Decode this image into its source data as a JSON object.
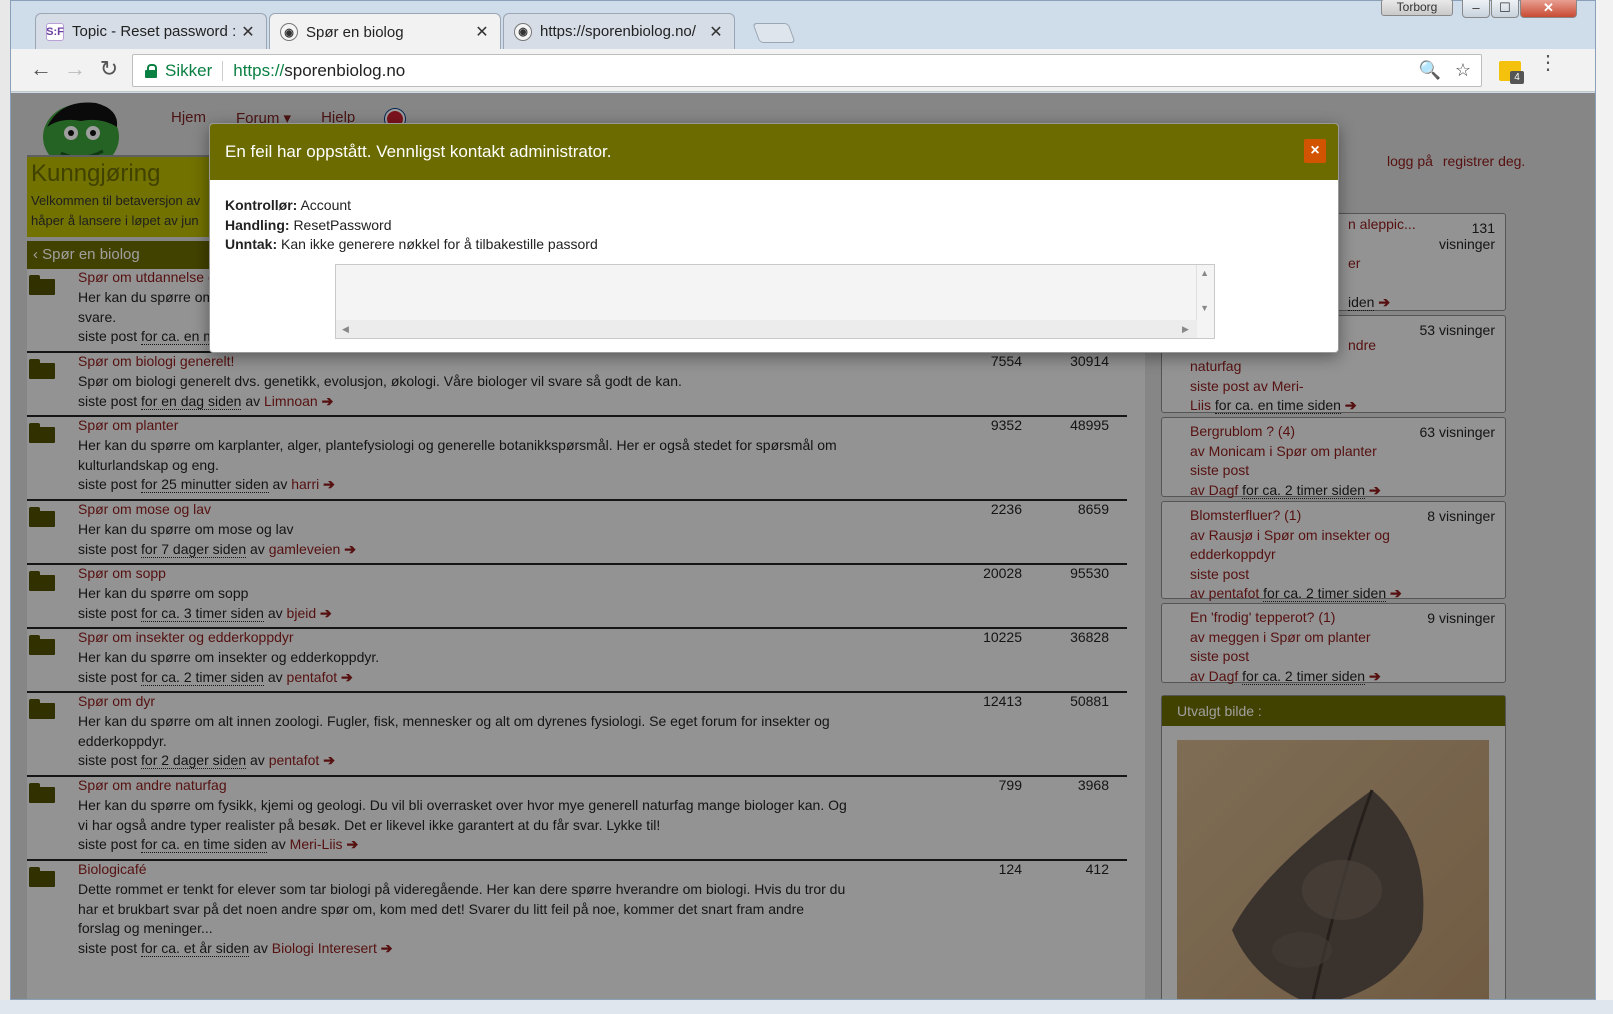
{
  "window": {
    "user_name": "Torborg",
    "min_glyph": "‒",
    "max_glyph": "☐",
    "close_glyph": "✕"
  },
  "tabs": [
    {
      "title": "Topic - Reset password :",
      "favicon": "S:F",
      "close": "✕"
    },
    {
      "title": "Spør en biolog",
      "favicon": "◉",
      "close": "✕"
    },
    {
      "title": "https://sporenbiolog.no/",
      "favicon": "◉",
      "close": "✕"
    }
  ],
  "toolbar": {
    "back": "←",
    "forward": "→",
    "reload": "↻",
    "secure_label": "Sikker",
    "url_scheme": "https://",
    "url_host": "sporenbiolog.no",
    "zoom_icon": "🔍",
    "star_icon": "☆",
    "ext_badge": "4",
    "menu": "⋮"
  },
  "nav": {
    "home": "Hjem",
    "forum": "Forum ▾",
    "help": "Hjelp"
  },
  "announcement": {
    "title": "Kunngjøring",
    "line1": "Velkommen til betaversjon av",
    "line2": "håper å lansere i løpet av jun"
  },
  "auth": {
    "login": "logg på",
    "register": "registrer deg."
  },
  "breadcrumb": "Spør en biolog",
  "forums": [
    {
      "title": "Spør om utdannelse o",
      "desc": "Her kan du spørre om",
      "desc2": "svare.",
      "ago": "for ca. en m",
      "by": "",
      "n1": "",
      "n2": ""
    },
    {
      "title": "Spør om biologi generelt!",
      "desc": "Spør om biologi generelt dvs. genetikk, evolusjon, økologi. Våre biologer vil svare så godt de kan.",
      "ago": "for en dag siden",
      "by": "Limnoan",
      "n1": "7554",
      "n2": "30914"
    },
    {
      "title": "Spør om planter",
      "desc": "Her kan du spørre om karplanter, alger, plantefysiologi og generelle botanikkspørsmål. Her er også stedet for spørsmål om kulturlandskap og eng.",
      "ago": "for 25 minutter siden",
      "by": "harri",
      "n1": "9352",
      "n2": "48995"
    },
    {
      "title": "Spør om mose og lav",
      "desc": "Her kan du spørre om mose og lav",
      "ago": "for 7 dager siden",
      "by": "gamleveien",
      "n1": "2236",
      "n2": "8659"
    },
    {
      "title": "Spør om sopp",
      "desc": "Her kan du spørre om sopp",
      "ago": "for ca. 3 timer siden",
      "by": "bjeid",
      "n1": "20028",
      "n2": "95530"
    },
    {
      "title": "Spør om insekter og edderkoppdyr",
      "desc": "Her kan du spørre om insekter og edderkoppdyr.",
      "ago": "for ca. 2 timer siden",
      "by": "pentafot",
      "n1": "10225",
      "n2": "36828"
    },
    {
      "title": "Spør om dyr",
      "desc": "Her kan du spørre om alt innen zoologi. Fugler, fisk, mennesker og alt om dyrenes fysiologi. Se eget forum for insekter og edderkoppdyr.",
      "ago": "for 2 dager siden",
      "by": "pentafot",
      "n1": "12413",
      "n2": "50881"
    },
    {
      "title": "Spør om andre naturfag",
      "desc": "Her kan du spørre om fysikk, kjemi og geologi. Du vil bli overrasket over hvor mye generell naturfag mange biologer kan. Og vi har også andre typer realister på besøk. Det er likevel ikke garantert at du får svar. Lykke til!",
      "ago": "for ca. en time siden",
      "by": "Meri-Liis",
      "n1": "799",
      "n2": "3968"
    },
    {
      "title": "Biologicafé",
      "desc": "Dette rommet er tenkt for elever som tar biologi på videregående. Her kan dere spørre hverandre om biologi. Hvis du tror du har et brukbart svar på det noen andre spør om, kom med det! Svarer du litt feil på noe, kommer det snart fram andre forslag og meninger...",
      "ago": "for ca. et år siden",
      "by": "Biologi Interesert",
      "n1": "124",
      "n2": "412"
    }
  ],
  "labels": {
    "last_post": "siste post",
    "by": "av",
    "arrow": "➔"
  },
  "sidebar": {
    "card0": {
      "title_fragment": "n aleppic...",
      "views": "131",
      "views_label": "visninger",
      "l2": "er",
      "ago": "iden"
    },
    "card1": {
      "views": "53 visninger",
      "frag": "ndre",
      "l1": "naturfag",
      "l2": "siste post av Meri-",
      "l3a": "Liis",
      "ago": "for ca. en time siden"
    },
    "card2": {
      "title": "Bergrublom ? (4)",
      "views": "63 visninger",
      "l1": "av Monicam i Spør om planter",
      "l2": "siste post",
      "l3a": "av Dagf",
      "ago": "for ca. 2 timer siden"
    },
    "card3": {
      "title": "Blomsterfluer? (1)",
      "views": "8 visninger",
      "l1": "av Rausjø i Spør om insekter og",
      "l1b": "edderkoppdyr",
      "l2": "siste post",
      "l3a": "av pentafot",
      "ago": "for ca. 2 timer siden"
    },
    "card4": {
      "title": "En 'frodig' tepperot? (1)",
      "views": "9 visninger",
      "l1": "av meggen i Spør om planter",
      "l2": "siste post",
      "l3a": "av Dagf",
      "ago": "for ca. 2 timer siden"
    },
    "photo_title": "Utvalgt bilde :"
  },
  "modal": {
    "title": "En feil har oppstått. Vennligst kontakt administrator.",
    "close": "×",
    "controller_label": "Kontrollør:",
    "controller": "Account",
    "action_label": "Handling:",
    "action": "ResetPassword",
    "exception_label": "Unntak:",
    "exception": "Kan ikke generere nøkkel for å tilbakestille passord",
    "stacktrace": ""
  }
}
